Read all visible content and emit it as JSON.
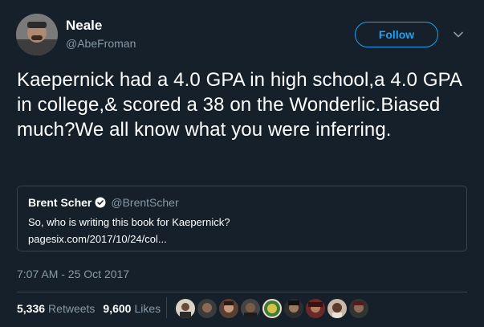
{
  "user": {
    "display_name": "Neale",
    "handle": "@AbeFroman",
    "follow_label": "Follow"
  },
  "tweet": {
    "text": "Kaepernick had a 4.0 GPA in high school,a 4.0 GPA in college,& scored a 38 on the Wonderlic.Biased much?We all know what you were inferring.",
    "timestamp": "7:07 AM - 25 Oct 2017"
  },
  "quoted": {
    "name": "Brent Scher",
    "handle": "@BrentScher",
    "text": "So, who is writing this book for Kaepernick?",
    "link": "pagesix.com/2017/10/24/col..."
  },
  "stats": {
    "retweets_count": "5,336",
    "retweets_label": "Retweets",
    "likes_count": "9,600",
    "likes_label": "Likes"
  },
  "colors": {
    "background": "#15202b",
    "accent": "#1da1f2",
    "muted": "#8899a6",
    "border": "#38444d"
  },
  "icons": [
    "verified-badge-icon",
    "chevron-down-icon"
  ]
}
